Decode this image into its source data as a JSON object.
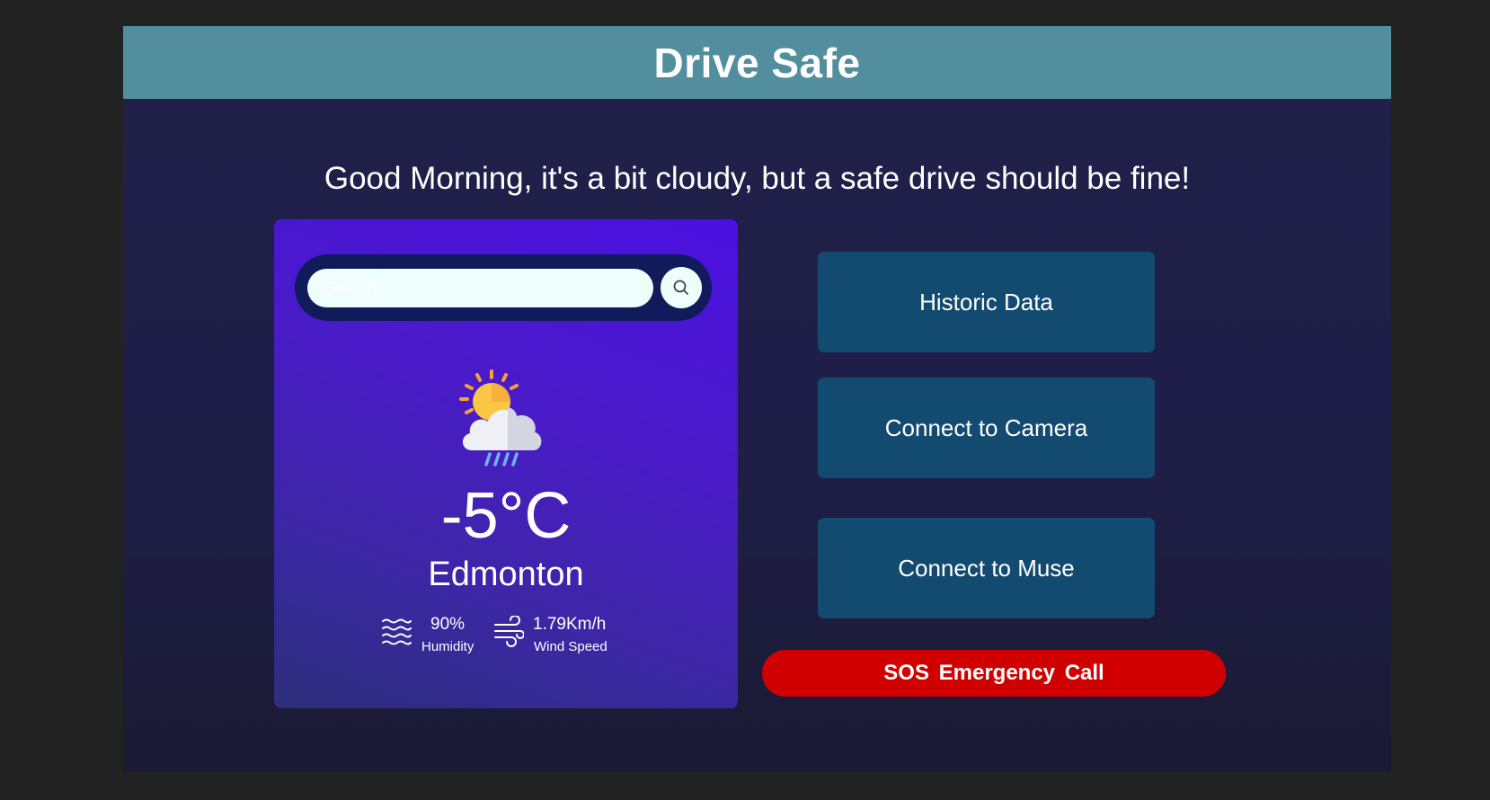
{
  "header": {
    "title": "Drive Safe"
  },
  "greeting": "Good Morning, it's a bit cloudy, but a safe drive should be fine!",
  "weather": {
    "search_placeholder": "Search",
    "icon": "partly-cloudy-rain-icon",
    "temperature": "-5°C",
    "city": "Edmonton",
    "humidity": {
      "value": "90%",
      "label": "Humidity",
      "icon": "humidity-waves-icon"
    },
    "wind": {
      "value": "1.79Km/h",
      "label": "Wind Speed",
      "icon": "wind-icon"
    }
  },
  "actions": {
    "historic": "Historic Data",
    "camera": "Connect to Camera",
    "muse": "Connect to Muse",
    "sos": "SOS  Emergency Call"
  },
  "colors": {
    "header_bg": "#528e9e",
    "card_gradient_start": "#4a10e0",
    "button_bg": "#134a70",
    "sos_bg": "#d10000"
  }
}
